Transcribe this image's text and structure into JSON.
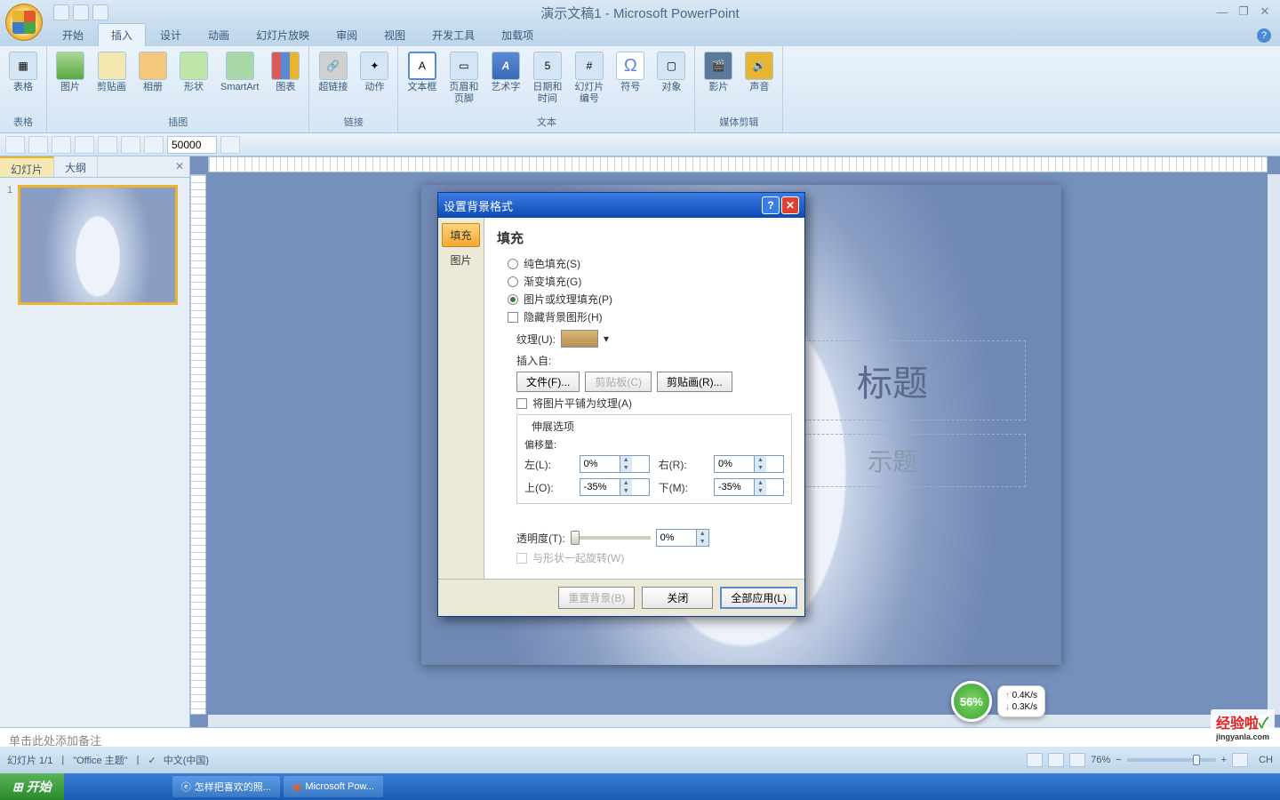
{
  "app": {
    "title": "演示文稿1 - Microsoft PowerPoint"
  },
  "tabs": {
    "home": "开始",
    "insert": "插入",
    "design": "设计",
    "anim": "动画",
    "slideshow": "幻灯片放映",
    "review": "审阅",
    "view": "视图",
    "dev": "开发工具",
    "addins": "加载项"
  },
  "ribbon": {
    "tables": {
      "label": "表格",
      "table": "表格"
    },
    "illust": {
      "label": "插图",
      "pic": "图片",
      "clip": "剪贴画",
      "album": "相册",
      "shapes": "形状",
      "smart": "SmartArt",
      "chart": "图表"
    },
    "links": {
      "label": "链接",
      "hyperlink": "超链接",
      "action": "动作"
    },
    "text": {
      "label": "文本",
      "textbox": "文本框",
      "header": "页眉和\n页脚",
      "wordart": "艺术字",
      "datetime": "日期和\n时间",
      "slidenum": "幻灯片\n编号",
      "symbol": "符号",
      "object": "对象"
    },
    "media": {
      "label": "媒体剪辑",
      "movie": "影片",
      "sound": "声音"
    }
  },
  "quickrow": {
    "value": "50000"
  },
  "panel": {
    "slides_tab": "幻灯片",
    "outline_tab": "大纲",
    "thumb_num": "1"
  },
  "canvas": {
    "title_placeholder": "标题",
    "subtitle_placeholder": "示题"
  },
  "notes": {
    "placeholder": "单击此处添加备注"
  },
  "status": {
    "slide": "幻灯片 1/1",
    "theme": "\"Office 主题\"",
    "lang": "中文(中国)",
    "lang_ind": "CH",
    "zoom": "76%"
  },
  "net": {
    "pct": "56%",
    "up": "0.4K/s",
    "dn": "0.3K/s"
  },
  "watermark": {
    "brand": "经验啦",
    "url": "jingyanla.com"
  },
  "taskbar": {
    "start": "开始",
    "task1": "怎样把喜欢的照...",
    "task2": "Microsoft Pow..."
  },
  "dialog": {
    "title": "设置背景格式",
    "nav_fill": "填充",
    "nav_pic": "图片",
    "heading": "填充",
    "r_solid": "纯色填充(S)",
    "r_gradient": "渐变填充(G)",
    "r_pictex": "图片或纹理填充(P)",
    "c_hidebg": "隐藏背景图形(H)",
    "texture_label": "纹理(U):",
    "insert_from": "插入自:",
    "btn_file": "文件(F)...",
    "btn_clipboard": "剪贴板(C)",
    "btn_clipart": "剪贴画(R)...",
    "c_tile": "将图片平铺为纹理(A)",
    "stretch_opts": "伸展选项",
    "offset": "偏移量:",
    "left": "左(L):",
    "right": "右(R):",
    "top": "上(O):",
    "bottom": "下(M):",
    "left_v": "0%",
    "right_v": "0%",
    "top_v": "-35%",
    "bottom_v": "-35%",
    "transparency": "透明度(T):",
    "trans_v": "0%",
    "c_rotate": "与形状一起旋转(W)",
    "btn_reset": "重置背景(B)",
    "btn_close": "关闭",
    "btn_applyall": "全部应用(L)"
  }
}
